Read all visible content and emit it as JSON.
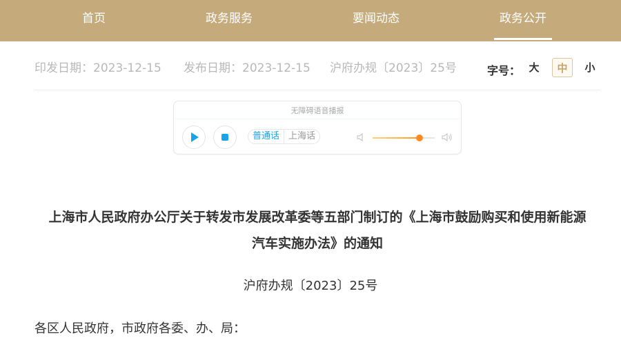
{
  "nav": {
    "items": [
      {
        "label": "首页",
        "active": false
      },
      {
        "label": "政务服务",
        "active": false
      },
      {
        "label": "要闻动态",
        "active": false
      },
      {
        "label": "政务公开",
        "active": true
      }
    ],
    "background": "#c5ab7b"
  },
  "meta": {
    "print_date": "印发日期：2023-12-15",
    "publish_date": "发布日期：2023-12-15",
    "doc_code": "沪府办规〔2023〕25号"
  },
  "font_size": {
    "label": "字号：",
    "options": [
      "大",
      "中",
      "小"
    ],
    "selected": "中"
  },
  "player": {
    "title": "无障碍语音播报",
    "play_icon": "play-icon",
    "stop_icon": "stop-icon",
    "languages": [
      "普通话",
      "上海话"
    ],
    "selected_language": "普通话",
    "volume_level": 0.75,
    "accent": "#1aa3e8",
    "volume_color": "#ff8a1f"
  },
  "document": {
    "title_line1": "上海市人民政府办公厅关于转发市发展改革委等五部门制订的《上海市鼓励购买和使用新能源",
    "title_line2": "汽车实施办法》的通知",
    "number": "沪府办规〔2023〕25号",
    "salutation": "各区人民政府，市政府各委、办、局："
  }
}
